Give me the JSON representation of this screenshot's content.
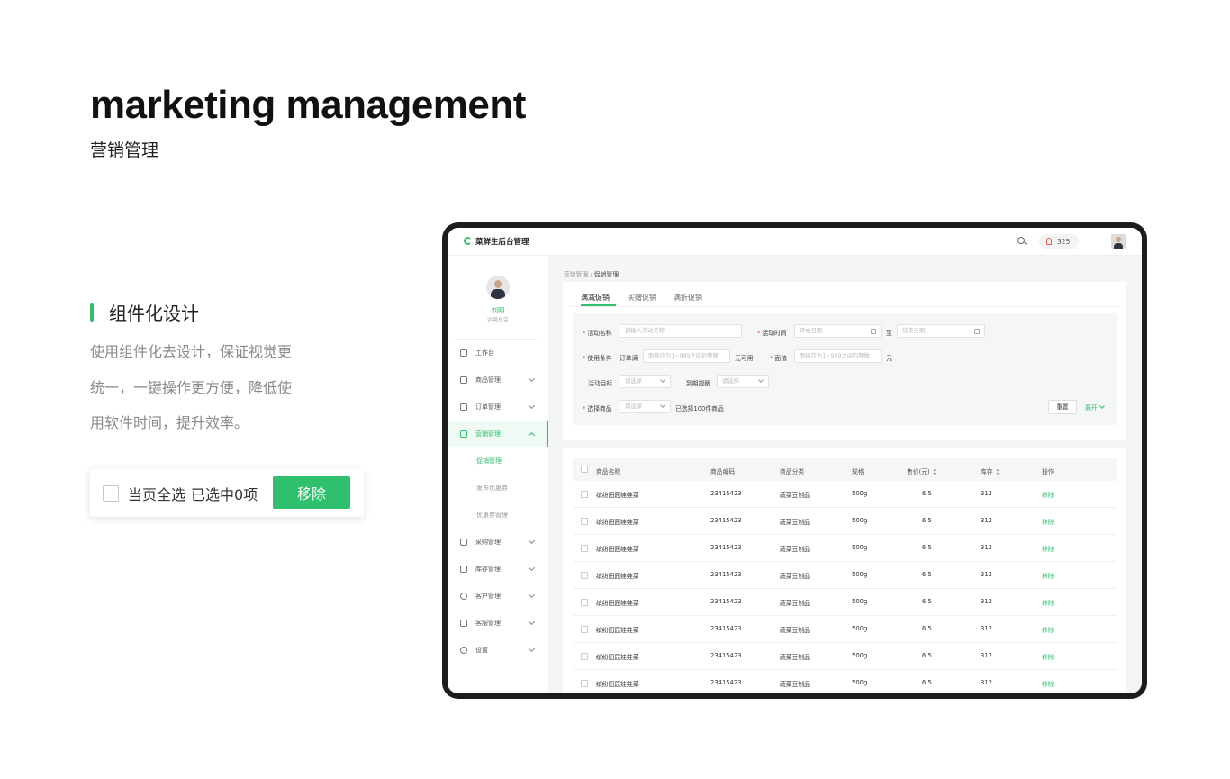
{
  "hero": {
    "title": "marketing management",
    "subtitle": "营销管理"
  },
  "feature": {
    "title": "组件化设计",
    "desc_lines": [
      "使用组件化去设计，保证视觉更",
      "统一，一键操作更方便，降低使",
      "用软件时间，提升效率。"
    ]
  },
  "select_card": {
    "select_all": "当页全选",
    "selected": "已选中0项",
    "remove": "移除"
  },
  "app": {
    "title": "菜鲜生后台管理",
    "notif_count": "325",
    "user": {
      "name": "刘明",
      "role": "运营总监"
    },
    "nav": [
      {
        "label": "工作台",
        "icon": "monitor-icon"
      },
      {
        "label": "商品管理",
        "icon": "bag-icon"
      },
      {
        "label": "订单管理",
        "icon": "document-icon"
      },
      {
        "label": "营销管理",
        "icon": "chart-icon"
      },
      {
        "label": "采购管理",
        "icon": "cart-icon"
      },
      {
        "label": "库存管理",
        "icon": "warehouse-icon"
      },
      {
        "label": "客户管理",
        "icon": "user-icon"
      },
      {
        "label": "客服管理",
        "icon": "headset-icon"
      },
      {
        "label": "设置",
        "icon": "gear-icon"
      }
    ],
    "subnav": [
      "促销管理",
      "发布优惠券",
      "优惠券管理"
    ],
    "breadcrumb": {
      "parent": "营销管理",
      "sep": "/",
      "current": "促销管理"
    },
    "tabs": [
      "满减促销",
      "买赠促销",
      "满折促销"
    ],
    "filter": {
      "activity_name": {
        "label": "活动名称",
        "placeholder": "请输入活动名称"
      },
      "activity_time": {
        "label": "活动时间",
        "start": "开始日期",
        "to": "至",
        "end": "结束日期"
      },
      "condition": {
        "label": "使用条件",
        "prefix": "订单满",
        "placeholder": "面值应为1~999之间的整数",
        "suffix": "元可用"
      },
      "value": {
        "label": "面值",
        "placeholder": "面值应为1~999之间的整数",
        "suffix": "元"
      },
      "target": {
        "label": "活动目标",
        "placeholder": "请选择"
      },
      "reminder": {
        "label": "到期提醒",
        "placeholder": "请选择"
      },
      "goods": {
        "label": "选择商品",
        "placeholder": "请选择",
        "note": "已选择100件商品"
      },
      "reset": "重置",
      "expand": "展开"
    },
    "table": {
      "headers": [
        "商品名称",
        "商品编码",
        "商品分类",
        "规格",
        "售价(元)",
        "库存",
        "操作"
      ],
      "rows": [
        [
          "缤纷田园娃娃菜",
          "23415423",
          "蔬菜豆制品",
          "500g",
          "6.5",
          "312",
          "移除"
        ],
        [
          "缤纷田园娃娃菜",
          "23415423",
          "蔬菜豆制品",
          "500g",
          "6.5",
          "312",
          "移除"
        ],
        [
          "缤纷田园娃娃菜",
          "23415423",
          "蔬菜豆制品",
          "500g",
          "6.5",
          "312",
          "移除"
        ],
        [
          "缤纷田园娃娃菜",
          "23415423",
          "蔬菜豆制品",
          "500g",
          "6.5",
          "312",
          "移除"
        ],
        [
          "缤纷田园娃娃菜",
          "23415423",
          "蔬菜豆制品",
          "500g",
          "6.5",
          "312",
          "移除"
        ],
        [
          "缤纷田园娃娃菜",
          "23415423",
          "蔬菜豆制品",
          "500g",
          "6.5",
          "312",
          "移除"
        ],
        [
          "缤纷田园娃娃菜",
          "23415423",
          "蔬菜豆制品",
          "500g",
          "6.5",
          "312",
          "移除"
        ],
        [
          "缤纷田园娃娃菜",
          "23415423",
          "蔬菜豆制品",
          "500g",
          "6.5",
          "312",
          "移除"
        ]
      ]
    }
  },
  "colors": {
    "accent": "#2fc06e",
    "required": "#e0584a"
  }
}
